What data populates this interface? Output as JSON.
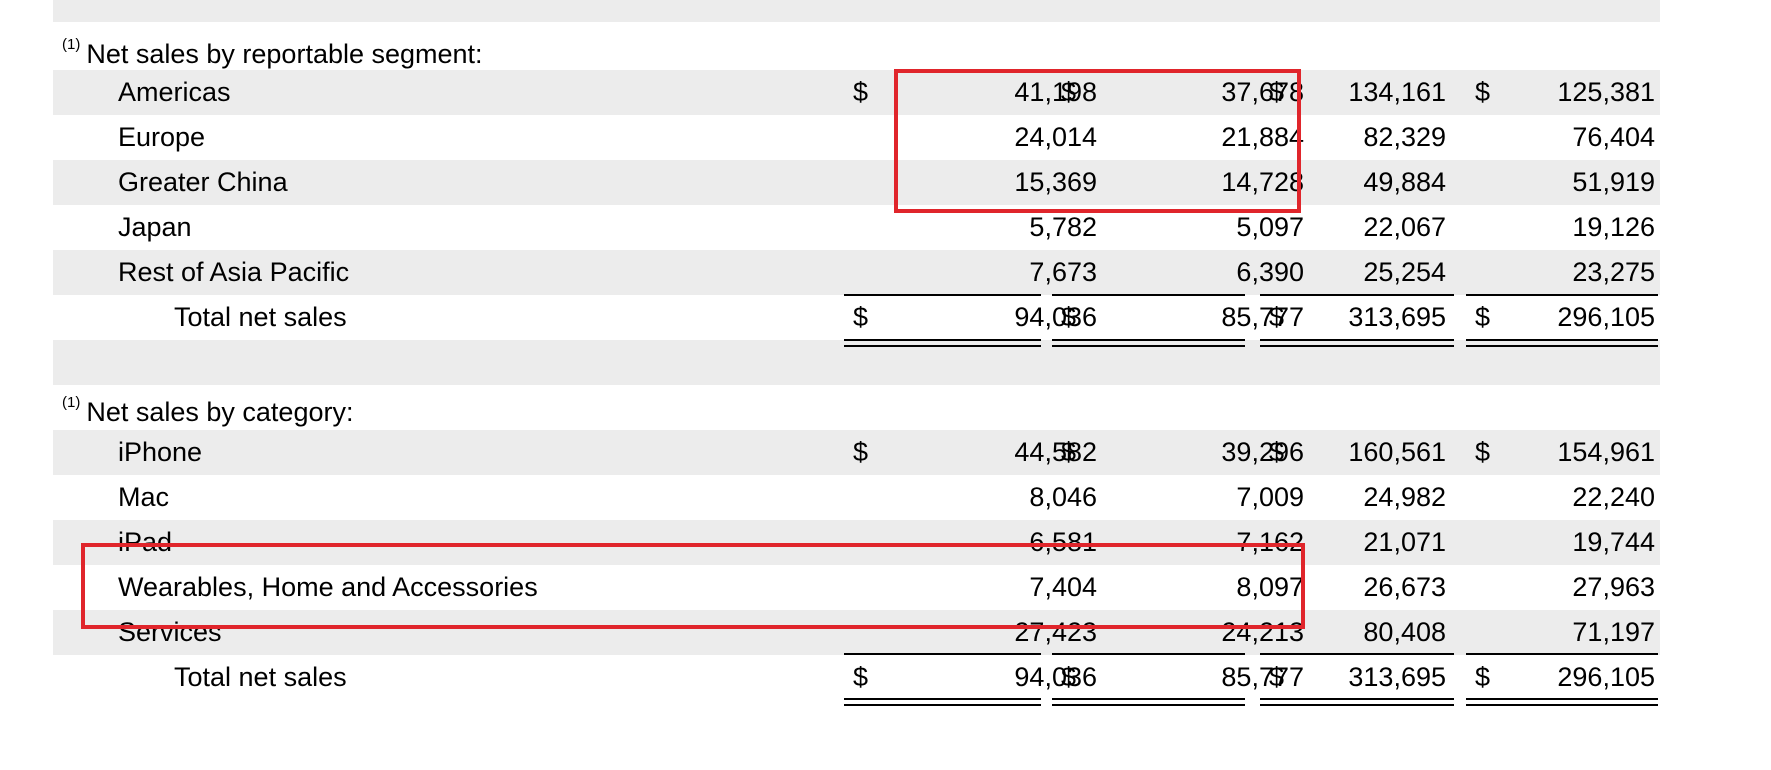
{
  "segment_section": {
    "footnote": "(1)",
    "title": "Net sales by reportable segment:",
    "rows": [
      {
        "label": "Americas",
        "dollar": "$",
        "values": [
          "41,198",
          "37,678",
          "134,161",
          "125,381"
        ]
      },
      {
        "label": "Europe",
        "dollar": "",
        "values": [
          "24,014",
          "21,884",
          "82,329",
          "76,404"
        ]
      },
      {
        "label": "Greater China",
        "dollar": "",
        "values": [
          "15,369",
          "14,728",
          "49,884",
          "51,919"
        ]
      },
      {
        "label": "Japan",
        "dollar": "",
        "values": [
          "5,782",
          "5,097",
          "22,067",
          "19,126"
        ]
      },
      {
        "label": "Rest of Asia Pacific",
        "dollar": "",
        "values": [
          "7,673",
          "6,390",
          "25,254",
          "23,275"
        ]
      }
    ],
    "total": {
      "label": "Total net sales",
      "dollar": "$",
      "values": [
        "94,036",
        "85,777",
        "313,695",
        "296,105"
      ]
    }
  },
  "category_section": {
    "footnote": "(1)",
    "title": "Net sales by category:",
    "rows": [
      {
        "label": "iPhone",
        "dollar": "$",
        "values": [
          "44,582",
          "39,296",
          "160,561",
          "154,961"
        ]
      },
      {
        "label": "Mac",
        "dollar": "",
        "values": [
          "8,046",
          "7,009",
          "24,982",
          "22,240"
        ]
      },
      {
        "label": "iPad",
        "dollar": "",
        "values": [
          "6,581",
          "7,162",
          "21,071",
          "19,744"
        ]
      },
      {
        "label": "Wearables, Home and Accessories",
        "dollar": "",
        "values": [
          "7,404",
          "8,097",
          "26,673",
          "27,963"
        ]
      },
      {
        "label": "Services",
        "dollar": "",
        "values": [
          "27,423",
          "24,213",
          "80,408",
          "71,197"
        ]
      }
    ],
    "total": {
      "label": "Total net sales",
      "dollar": "$",
      "values": [
        "94,036",
        "85,777",
        "313,695",
        "296,105"
      ]
    }
  },
  "highlight_color": "#e0252b"
}
